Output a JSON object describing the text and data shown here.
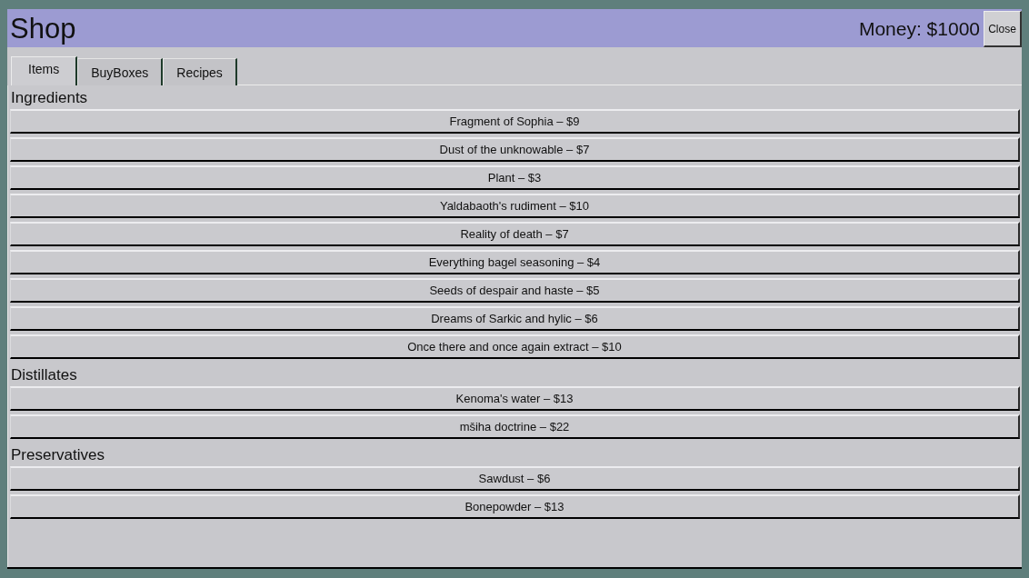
{
  "window": {
    "title": "Shop",
    "money": "Money: $1000",
    "close_button": "Close"
  },
  "tabs": [
    {
      "label": "Items",
      "selected": true
    },
    {
      "label": "BuyBoxes",
      "selected": false
    },
    {
      "label": "Recipes",
      "selected": false
    }
  ],
  "sections": [
    {
      "title": "Ingredients",
      "items": [
        "Fragment of Sophia – $9",
        "Dust of the unknowable – $7",
        "Plant – $3",
        "Yaldabaoth's rudiment – $10",
        "Reality of death – $7",
        "Everything bagel seasoning – $4",
        "Seeds of despair and haste – $5",
        "Dreams of Sarkic and hylic – $6",
        "Once there and once again extract – $10"
      ]
    },
    {
      "title": "Distillates",
      "items": [
        "Kenoma's water – $13",
        "mšiha doctrine – $22"
      ]
    },
    {
      "title": "Preservatives",
      "items": [
        "Sawdust – $6",
        "Bonepowder – $13"
      ]
    }
  ]
}
